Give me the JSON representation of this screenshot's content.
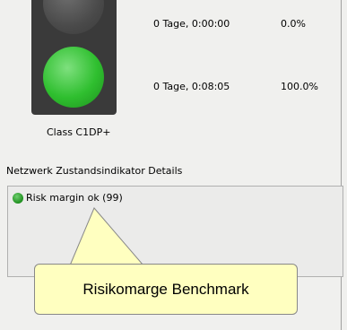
{
  "traffic_light": {
    "class_label": "Class C1DP+",
    "rows": [
      {
        "time": "0 Tage, 0:00:00",
        "percent": "0.0%"
      },
      {
        "time": "0 Tage, 0:08:05",
        "percent": "100.0%"
      }
    ]
  },
  "details": {
    "title": "Netzwerk Zustandsindikator Details",
    "status_text": "Risk margin ok (99)",
    "status_color": "#2fbf2f"
  },
  "callout": {
    "text": "Risikomarge Benchmark"
  }
}
